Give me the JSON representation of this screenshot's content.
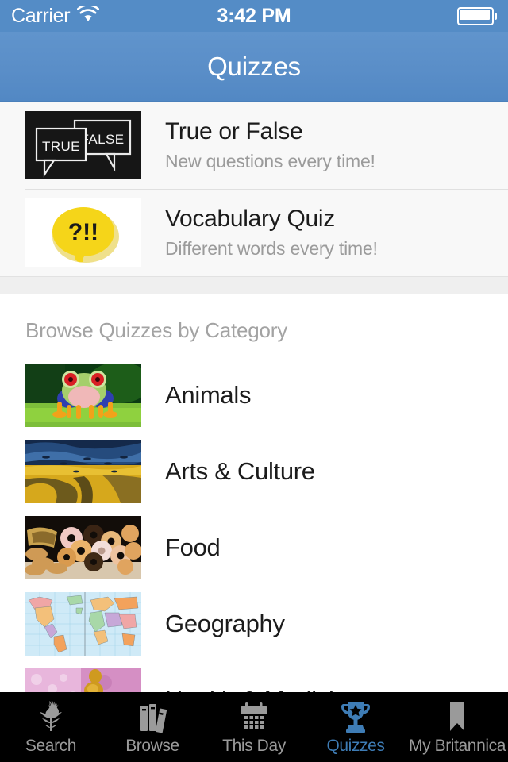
{
  "status_bar": {
    "carrier": "Carrier",
    "wifi_icon": "wifi-icon",
    "time": "3:42 PM",
    "battery_icon": "battery-icon"
  },
  "nav_bar": {
    "title": "Quizzes",
    "background_color": "#5a8ec8"
  },
  "featured_quizzes": [
    {
      "thumb_name": "true-false-thumbnail",
      "title": "True or False",
      "subtitle": "New questions every time!"
    },
    {
      "thumb_name": "vocabulary-quiz-thumbnail",
      "title": "Vocabulary Quiz",
      "subtitle": "Different words every time!"
    }
  ],
  "category_section": {
    "header": "Browse Quizzes by Category",
    "categories": [
      {
        "label": "Animals",
        "thumb_name": "frog-thumbnail"
      },
      {
        "label": "Arts & Culture",
        "thumb_name": "painting-thumbnail"
      },
      {
        "label": "Food",
        "thumb_name": "pastries-thumbnail"
      },
      {
        "label": "Geography",
        "thumb_name": "world-map-thumbnail"
      },
      {
        "label": "Health & Medicine",
        "thumb_name": "microscopy-thumbnail"
      }
    ]
  },
  "tab_bar": {
    "active_color": "#3e7cb5",
    "inactive_color": "#9a9a9a",
    "tabs": [
      {
        "label": "Search",
        "icon": "thistle-icon",
        "active": false
      },
      {
        "label": "Browse",
        "icon": "books-icon",
        "active": false
      },
      {
        "label": "This Day",
        "icon": "calendar-icon",
        "active": false
      },
      {
        "label": "Quizzes",
        "icon": "trophy-icon",
        "active": true
      },
      {
        "label": "My Britannica",
        "icon": "bookmark-icon",
        "active": false
      }
    ]
  },
  "thumbnail_text": {
    "true_label": "TRUE",
    "false_label": "FALSE",
    "vocab_marks": "?!!"
  }
}
